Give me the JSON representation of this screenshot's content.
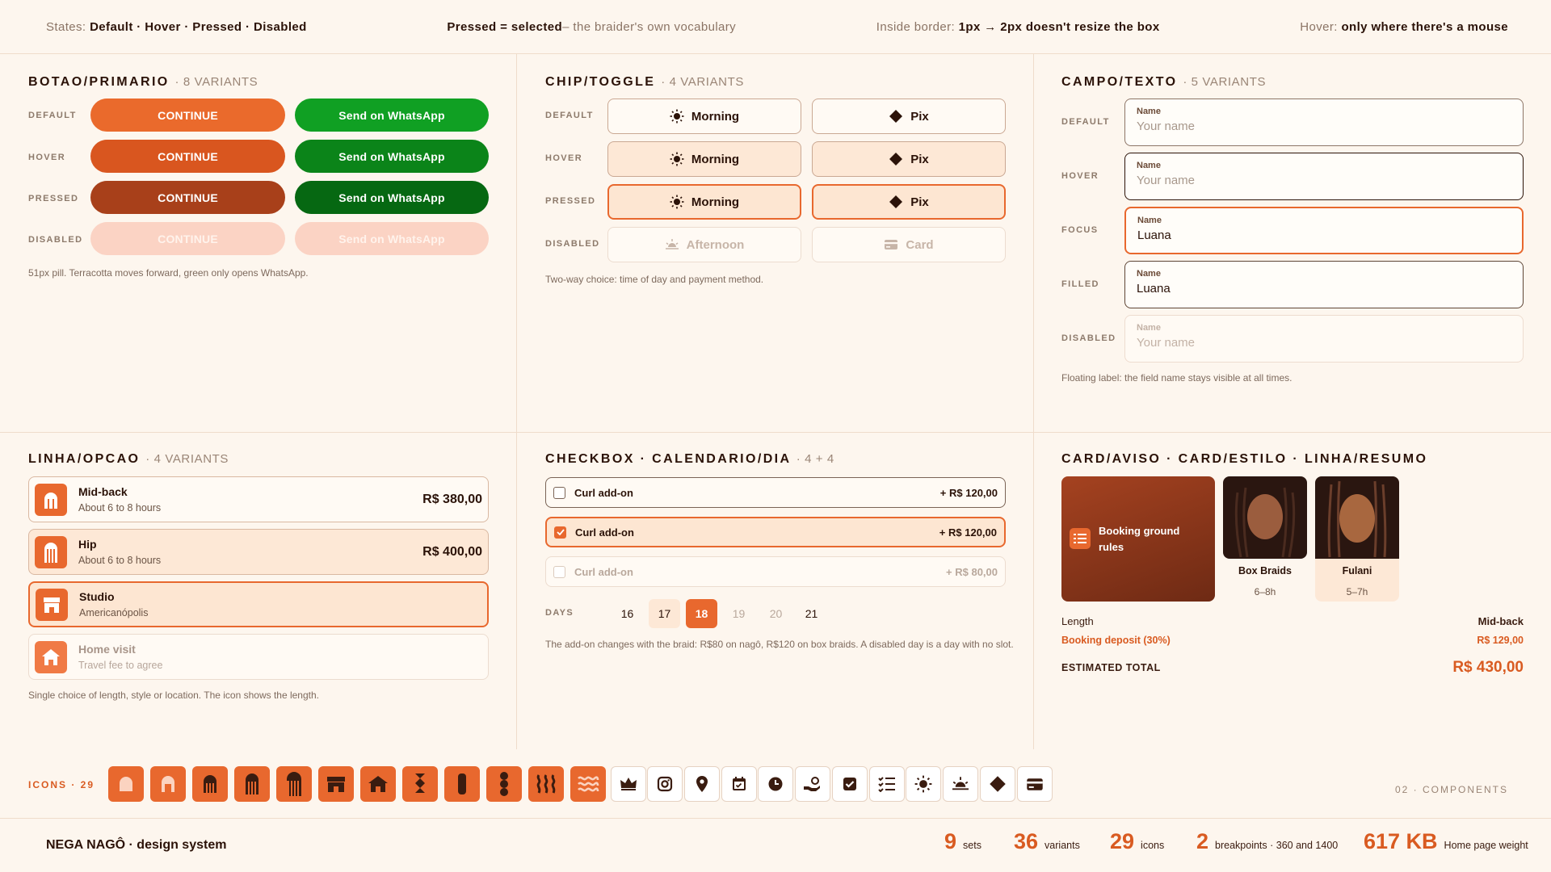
{
  "topbar": {
    "states_label": "States:",
    "states_value": "Default · Hover · Pressed · Disabled",
    "pressed_value": "Pressed = selected",
    "pressed_desc": "– the braider's own vocabulary",
    "border_label": "Inside border:",
    "border_value": "1px → 2px doesn't resize the box",
    "hover_label": "Hover:",
    "hover_value": "only where there's a mouse"
  },
  "botao": {
    "title": "BOTAO/PRIMARIO",
    "subtitle": "· 8 VARIANTS",
    "rows": [
      "DEFAULT",
      "HOVER",
      "PRESSED",
      "DISABLED"
    ],
    "primary_label": "CONTINUE",
    "whatsapp_label": "Send on WhatsApp",
    "note": "51px pill. Terracotta moves forward, green only opens WhatsApp."
  },
  "chip": {
    "title": "CHIP/TOGGLE",
    "subtitle": "· 4 VARIANTS",
    "rows": [
      "DEFAULT",
      "HOVER",
      "PRESSED",
      "DISABLED"
    ],
    "morning": "Morning",
    "afternoon": "Afternoon",
    "pix": "Pix",
    "card": "Card",
    "note": "Two-way choice: time of day and payment method."
  },
  "campo": {
    "title": "CAMPO/TEXTO",
    "subtitle": "· 5 VARIANTS",
    "rows": [
      "DEFAULT",
      "HOVER",
      "FOCUS",
      "FILLED",
      "DISABLED"
    ],
    "field_label": "Name",
    "placeholder": "Your name",
    "value": "Luana",
    "note": "Floating label: the field name stays visible at all times."
  },
  "linha": {
    "title": "LINHA/OPCAO",
    "subtitle": "· 4 VARIANTS",
    "options": [
      {
        "t1": "Mid-back",
        "t2": "About 6 to 8 hours",
        "price": "R$ 380,00"
      },
      {
        "t1": "Hip",
        "t2": "About 6 to 8 hours",
        "price": "R$ 400,00"
      },
      {
        "t1": "Studio",
        "t2": "Americanópolis",
        "price": ""
      },
      {
        "t1": "Home visit",
        "t2": "Travel fee to agree",
        "price": ""
      }
    ],
    "note": "Single choice of length, style or location. The icon shows the length."
  },
  "checkbox": {
    "title": "CHECKBOX · CALENDARIO/DIA",
    "subtitle": "· 4 + 4",
    "items": [
      {
        "label": "Curl add-on",
        "price": "+ R$ 120,00"
      },
      {
        "label": "Curl add-on",
        "price": "+ R$ 120,00"
      },
      {
        "label": "Curl add-on",
        "price": "+ R$ 80,00"
      }
    ],
    "days_label": "DAYS",
    "days": [
      "16",
      "17",
      "18",
      "19",
      "20",
      "21"
    ],
    "note": "The add-on changes with the braid: R$80 on nagô, R$120 on box braids. A disabled day is a day with no slot."
  },
  "card": {
    "title": "CARD/AVISO · CARD/ESTILO · LINHA/RESUMO",
    "aviso": "Booking ground rules",
    "styles": [
      {
        "name": "Box Braids",
        "time": "6–8h"
      },
      {
        "name": "Fulani",
        "time": "5–7h"
      }
    ],
    "summary": [
      {
        "label": "Length",
        "value": "Mid-back"
      },
      {
        "label": "Booking deposit (30%)",
        "value": "R$ 129,00"
      },
      {
        "label": "ESTIMATED TOTAL",
        "value": "R$ 430,00"
      }
    ]
  },
  "icons": {
    "label": "ICONS · 29",
    "page": "02 · COMPONENTS"
  },
  "footer": {
    "brand": "NEGA NAGÔ · design system",
    "stats": [
      {
        "n": "9",
        "l": "sets"
      },
      {
        "n": "36",
        "l": "variants"
      },
      {
        "n": "29",
        "l": "icons"
      },
      {
        "n": "2",
        "l": "breakpoints · 360 and 1400"
      },
      {
        "n": "617 KB",
        "l": "Home page weight"
      }
    ]
  },
  "colors": {
    "terracotta": "#e8682e",
    "green": "#0f9a22",
    "brown": "#8f3a1a"
  }
}
